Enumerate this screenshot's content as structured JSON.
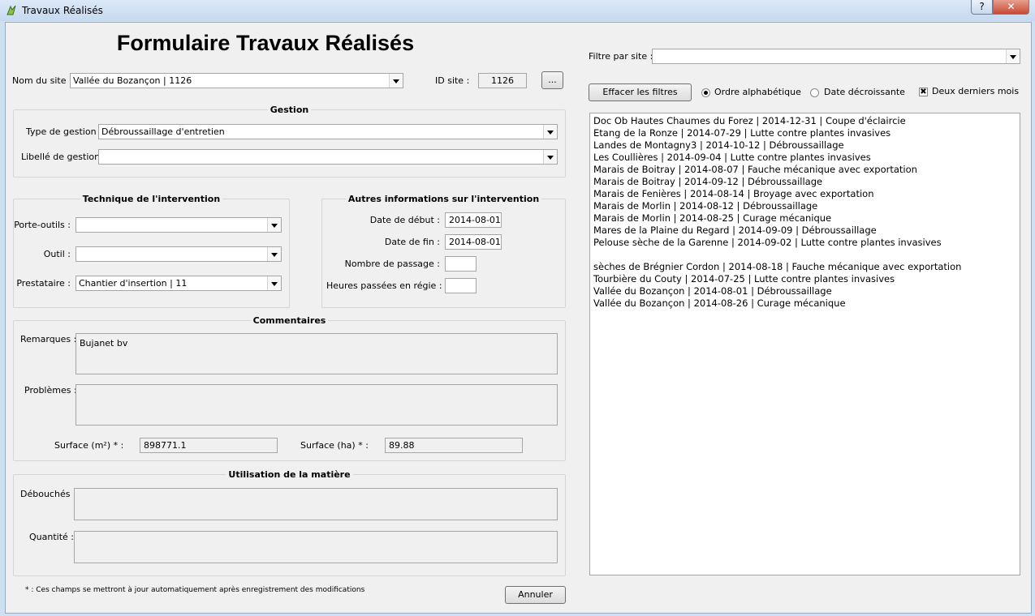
{
  "window": {
    "title": "Travaux Réalisés",
    "help": "?",
    "close": "✕"
  },
  "header": {
    "title": "Formulaire Travaux Réalisés"
  },
  "site": {
    "label": "Nom du site :",
    "value": "Vallée du Bozançon | 1126",
    "id_label": "ID site :",
    "id_value": "1126",
    "browse": "..."
  },
  "gestion": {
    "title": "Gestion",
    "type_label": "Type de gestion :",
    "type_value": "Débroussaillage d'entretien",
    "libelle_label": "Libellé de gestion :",
    "libelle_value": ""
  },
  "technique": {
    "title": "Technique de l'intervention",
    "porte_outils_label": "Porte-outils :",
    "porte_outils_value": "",
    "outil_label": "Outil :",
    "outil_value": "",
    "prestataire_label": "Prestataire :",
    "prestataire_value": "Chantier d'insertion | 11"
  },
  "autres": {
    "title": "Autres informations sur l'intervention",
    "date_debut_label": "Date de début :",
    "date_debut": "2014-08-01",
    "date_fin_label": "Date de fin :",
    "date_fin": "2014-08-01",
    "passage_label": "Nombre de passage :",
    "passage": "",
    "heures_label": "Heures passées en régie :",
    "heures": ""
  },
  "commentaires": {
    "title": "Commentaires",
    "remarques_label": "Remarques :",
    "remarques": "Bujanet bv",
    "problemes_label": "Problèmes :",
    "problemes": "",
    "surface_m2_label": "Surface (m²) * :",
    "surface_m2": "898771.1",
    "surface_ha_label": "Surface (ha) * :",
    "surface_ha": "89.88"
  },
  "matiere": {
    "title": "Utilisation de la matière",
    "debouches_label": "Débouchés :",
    "debouches": "",
    "quantite_label": "Quantité :",
    "quantite": ""
  },
  "footer": {
    "note": "* : Ces champs se mettront à jour automatiquement après enregistrement des modifications",
    "cancel": "Annuler"
  },
  "filter": {
    "label": "Filtre par site :",
    "value": "",
    "clear": "Effacer les filtres",
    "alpha": "Ordre alphabétique",
    "alpha_checked": true,
    "date_desc": "Date décroissante",
    "date_desc_checked": false,
    "two_months": "Deux derniers mois",
    "two_months_checked": true
  },
  "list": [
    "Doc Ob Hautes Chaumes du Forez | 2014-12-31 | Coupe d'éclaircie",
    "Etang de la Ronze | 2014-07-29 | Lutte contre plantes invasives",
    "Landes de Montagny3 | 2014-10-12 | Débroussaillage",
    "Les Coullières | 2014-09-04 | Lutte contre plantes invasives",
    "Marais de Boitray | 2014-08-07 | Fauche mécanique avec exportation",
    "Marais de Boitray | 2014-09-12 | Débroussaillage",
    "Marais de Fenières | 2014-08-14 | Broyage avec exportation",
    "Marais de Morlin | 2014-08-12 | Débroussaillage",
    "Marais de Morlin | 2014-08-25 | Curage mécanique",
    "Mares de la Plaine du Regard | 2014-09-09 | Débroussaillage",
    "Pelouse sèche de la Garenne | 2014-09-02 | Lutte contre plantes invasives",
    "",
    " sèches de Brégnier Cordon | 2014-08-18 | Fauche mécanique avec exportation",
    "Tourbière du Couty | 2014-07-25 | Lutte contre plantes invasives",
    "Vallée du Bozançon | 2014-08-01 | Débroussaillage",
    "Vallée du Bozançon | 2014-08-26 | Curage mécanique"
  ]
}
